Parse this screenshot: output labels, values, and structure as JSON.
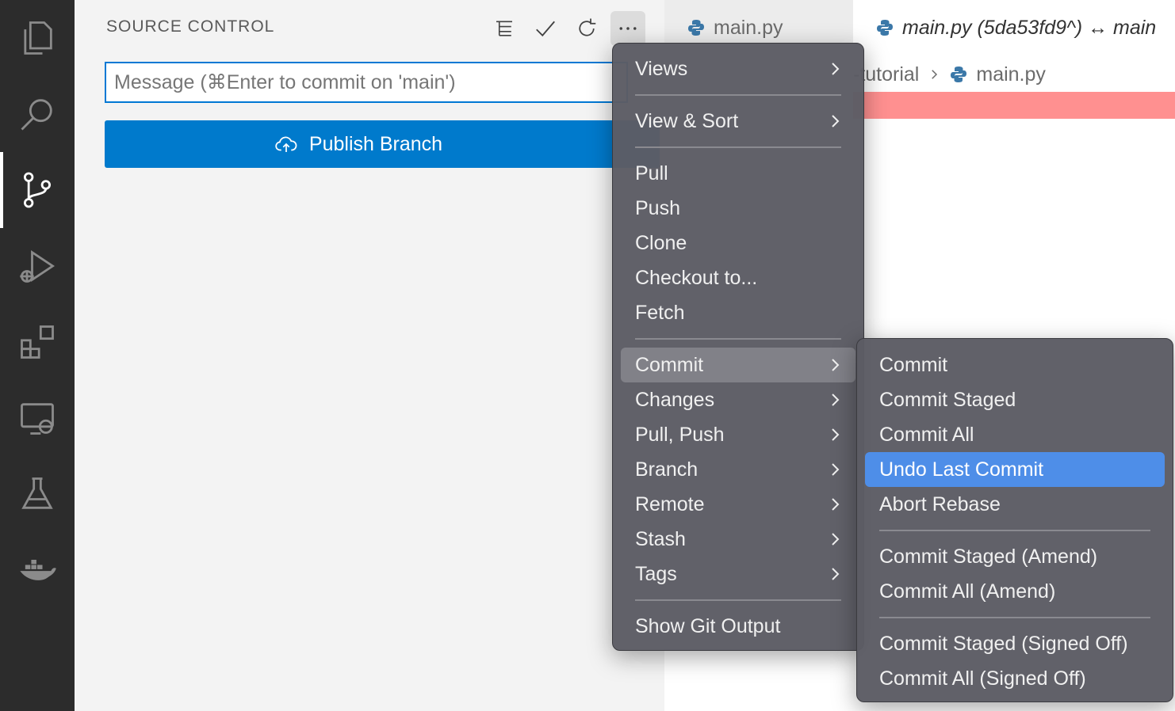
{
  "activity_bar": {
    "items": [
      {
        "name": "explorer-icon"
      },
      {
        "name": "search-icon"
      },
      {
        "name": "source-control-icon",
        "active": true
      },
      {
        "name": "run-debug-icon"
      },
      {
        "name": "extensions-icon"
      },
      {
        "name": "remote-explorer-icon"
      },
      {
        "name": "testing-icon"
      },
      {
        "name": "docker-icon"
      }
    ]
  },
  "sidebar": {
    "title": "SOURCE CONTROL",
    "toolbar": [
      "view-as-tree-icon",
      "commit-check-icon",
      "refresh-icon",
      "more-actions-icon"
    ],
    "message_input": {
      "value": "",
      "placeholder": "Message (⌘Enter to commit on 'main')"
    },
    "publish_button": {
      "label": "Publish Branch",
      "icon": "cloud-upload-icon"
    }
  },
  "editor": {
    "tabs": [
      {
        "label": "main.py",
        "active": false
      },
      {
        "label": "main.py (5da53fd9^) ↔ main",
        "active": true
      }
    ],
    "breadcrumb": {
      "folder": "-tutorial",
      "file": "main.py"
    }
  },
  "menu": {
    "items": [
      {
        "label": "Views",
        "submenu": true
      },
      {
        "label": "View & Sort",
        "submenu": true
      },
      {
        "label": "Pull"
      },
      {
        "label": "Push"
      },
      {
        "label": "Clone"
      },
      {
        "label": "Checkout to..."
      },
      {
        "label": "Fetch"
      },
      {
        "label": "Commit",
        "submenu": true,
        "selected": true
      },
      {
        "label": "Changes",
        "submenu": true
      },
      {
        "label": "Pull, Push",
        "submenu": true
      },
      {
        "label": "Branch",
        "submenu": true
      },
      {
        "label": "Remote",
        "submenu": true
      },
      {
        "label": "Stash",
        "submenu": true
      },
      {
        "label": "Tags",
        "submenu": true
      },
      {
        "label": "Show Git Output"
      }
    ]
  },
  "submenu": {
    "items": [
      {
        "label": "Commit"
      },
      {
        "label": "Commit Staged"
      },
      {
        "label": "Commit All"
      },
      {
        "label": "Undo Last Commit",
        "highlighted": true
      },
      {
        "label": "Abort Rebase"
      },
      {
        "label": "Commit Staged (Amend)"
      },
      {
        "label": "Commit All (Amend)"
      },
      {
        "label": "Commit Staged (Signed Off)"
      },
      {
        "label": "Commit All (Signed Off)"
      }
    ]
  },
  "colors": {
    "accent": "#007acc",
    "highlight": "#4e8ee8",
    "diff_removed": "#ff9090"
  }
}
